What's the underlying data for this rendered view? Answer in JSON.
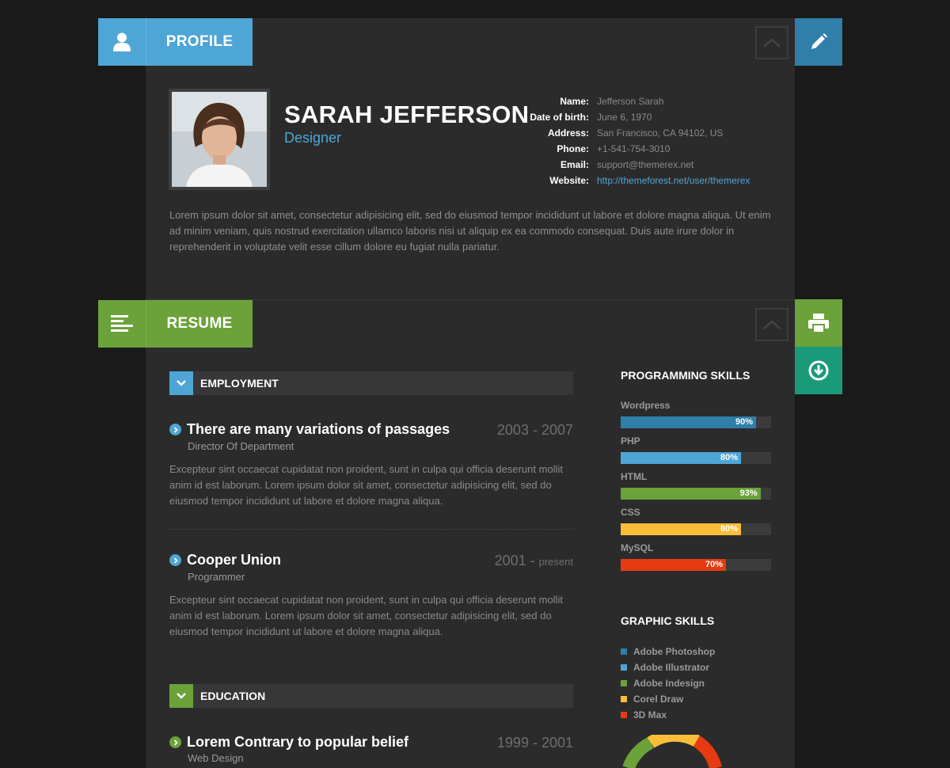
{
  "profile": {
    "tab_label": "PROFILE",
    "name": "SARAH JEFFERSON",
    "role": "Designer",
    "info": [
      {
        "key": "Name:",
        "value": "Jefferson Sarah"
      },
      {
        "key": "Date of birth:",
        "value": "June 6, 1970"
      },
      {
        "key": "Address:",
        "value": "San Francisco, CA 94102, US"
      },
      {
        "key": "Phone:",
        "value": "+1-541-754-3010"
      },
      {
        "key": "Email:",
        "value": "support@themerex.net"
      },
      {
        "key": "Website:",
        "value": "http://themeforest.net/user/themerex"
      }
    ],
    "bio": "Lorem ipsum dolor sit amet, consectetur adipisicing elit, sed do eiusmod tempor incididunt ut labore et dolore magna aliqua. Ut enim ad minim veniam, quis nostrud exercitation ullamco laboris nisi ut aliquip ex ea commodo consequat. Duis aute irure dolor in reprehenderit in voluptate velit esse cillum dolore eu fugiat nulla pariatur."
  },
  "resume": {
    "tab_label": "RESUME",
    "employment_label": "EMPLOYMENT",
    "education_label": "EDUCATION",
    "employment": [
      {
        "title": "There are many variations of passages",
        "subtitle": "Director Of Department",
        "date": "2003 - 2007",
        "date_suffix": "",
        "text": "Excepteur sint occaecat cupidatat non proident, sunt in culpa qui officia deserunt mollit anim id est laborum. Lorem ipsum dolor sit amet, consectetur adipisicing elit, sed do eiusmod tempor incididunt ut labore et dolore magna aliqua."
      },
      {
        "title": "Cooper Union",
        "subtitle": "Programmer",
        "date": "2001 - ",
        "date_suffix": "present",
        "text": "Excepteur sint occaecat cupidatat non proident, sunt in culpa qui officia deserunt mollit anim id est laborum. Lorem ipsum dolor sit amet, consectetur adipisicing elit, sed do eiusmod tempor incididunt ut labore et dolore magna aliqua."
      }
    ],
    "education": [
      {
        "title": "Lorem Contrary to popular belief",
        "subtitle": "Web Design",
        "date": "1999 - 2001"
      }
    ]
  },
  "sidebar": {
    "programming_heading": "PROGRAMMING SKILLS",
    "skills": [
      {
        "name": "Wordpress",
        "percent": 90,
        "label": "90%",
        "color": "#2f7fa8"
      },
      {
        "name": "PHP",
        "percent": 80,
        "label": "80%",
        "color": "#4ea6d6"
      },
      {
        "name": "HTML",
        "percent": 93,
        "label": "93%",
        "color": "#6ba23a"
      },
      {
        "name": "CSS",
        "percent": 80,
        "label": "80%",
        "color": "#fbbd38"
      },
      {
        "name": "MySQL",
        "percent": 70,
        "label": "70%",
        "color": "#e63a12"
      }
    ],
    "graphic_heading": "GRAPHIC SKILLS",
    "graphic_skills": [
      {
        "name": "Adobe Photoshop",
        "color": "#2f7fa8"
      },
      {
        "name": "Adobe Illustrator",
        "color": "#4ea6d6"
      },
      {
        "name": "Adobe Indesign",
        "color": "#6ba23a"
      },
      {
        "name": "Corel Draw",
        "color": "#fbbd38"
      },
      {
        "name": "3D Max",
        "color": "#e63a12"
      }
    ]
  },
  "colors": {
    "profile_accent": "#4ea6d6",
    "resume_accent": "#6ba23a",
    "edit_button": "#2f7fa8",
    "print_button": "#6ba23a",
    "download_button": "#1a9a78"
  },
  "icons": {
    "profile": "user-icon",
    "resume": "list-lines-icon",
    "edit": "pencil-icon",
    "print": "printer-icon",
    "download": "download-circle-icon",
    "collapse": "chevron-up-icon"
  }
}
